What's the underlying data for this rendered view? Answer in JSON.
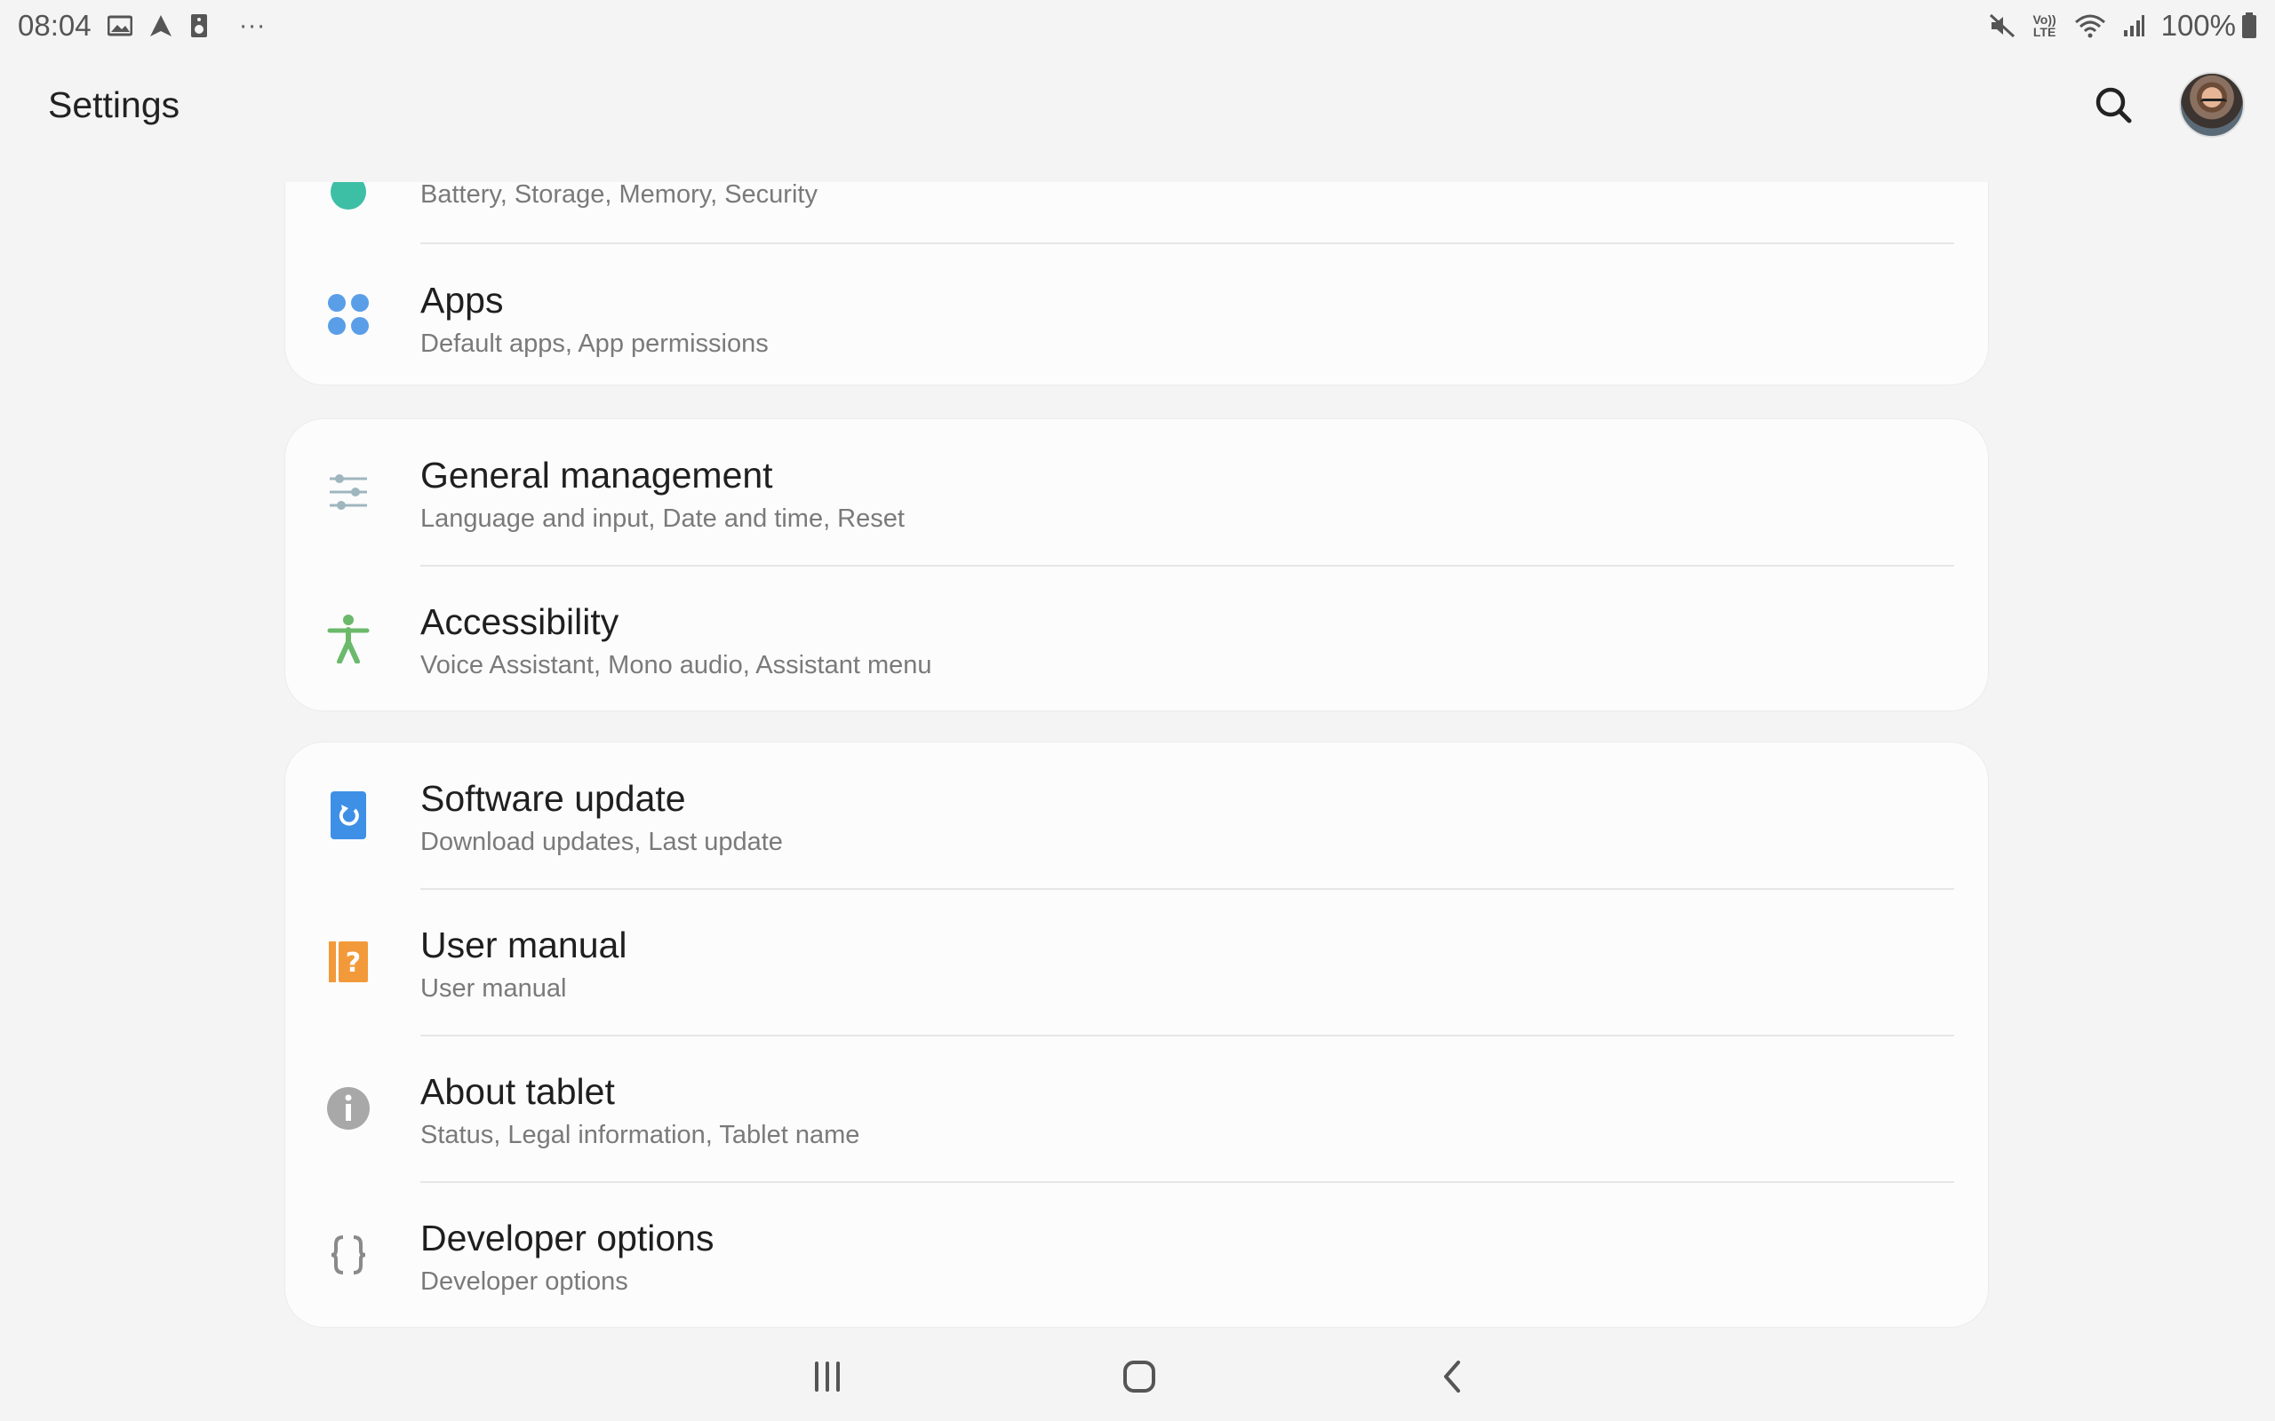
{
  "status_bar": {
    "time": "08:04",
    "battery_percent": "100%",
    "left_icons": [
      "gallery-icon",
      "navigation-arrow-icon",
      "speaker-icon",
      "more-dots-icon"
    ],
    "right_icons": [
      "mute-icon",
      "volte-icon",
      "wifi-icon",
      "signal-icon",
      "battery-icon"
    ],
    "volte_label": "Vo)) LTE",
    "more_label": "···"
  },
  "app_bar": {
    "title": "Settings",
    "search_icon": "search-icon",
    "avatar_icon": "profile-avatar"
  },
  "cards": [
    {
      "items": [
        {
          "title": "",
          "subtitle": "Battery, Storage, Memory, Security",
          "icon": "device-care-icon",
          "icon_color": "#3dbfa6"
        },
        {
          "title": "Apps",
          "subtitle": "Default apps, App permissions",
          "icon": "apps-icon",
          "icon_color": "#5a9ee8"
        }
      ]
    },
    {
      "items": [
        {
          "title": "General management",
          "subtitle": "Language and input, Date and time, Reset",
          "icon": "sliders-icon",
          "icon_color": "#9fb6bf"
        },
        {
          "title": "Accessibility",
          "subtitle": "Voice Assistant, Mono audio, Assistant menu",
          "icon": "accessibility-icon",
          "icon_color": "#6bb96b"
        }
      ]
    },
    {
      "items": [
        {
          "title": "Software update",
          "subtitle": "Download updates, Last update",
          "icon": "software-update-icon",
          "icon_color": "#3e8fe6"
        },
        {
          "title": "User manual",
          "subtitle": "User manual",
          "icon": "user-manual-icon",
          "icon_color": "#f29a3a"
        },
        {
          "title": "About tablet",
          "subtitle": "Status, Legal information, Tablet name",
          "icon": "info-icon",
          "icon_color": "#a8a8a8"
        },
        {
          "title": "Developer options",
          "subtitle": "Developer options",
          "icon": "developer-braces-icon",
          "icon_color": "#8a8a8a"
        }
      ]
    }
  ],
  "nav_bar": {
    "recents_icon": "recents-icon",
    "home_icon": "home-icon",
    "back_icon": "back-icon"
  }
}
